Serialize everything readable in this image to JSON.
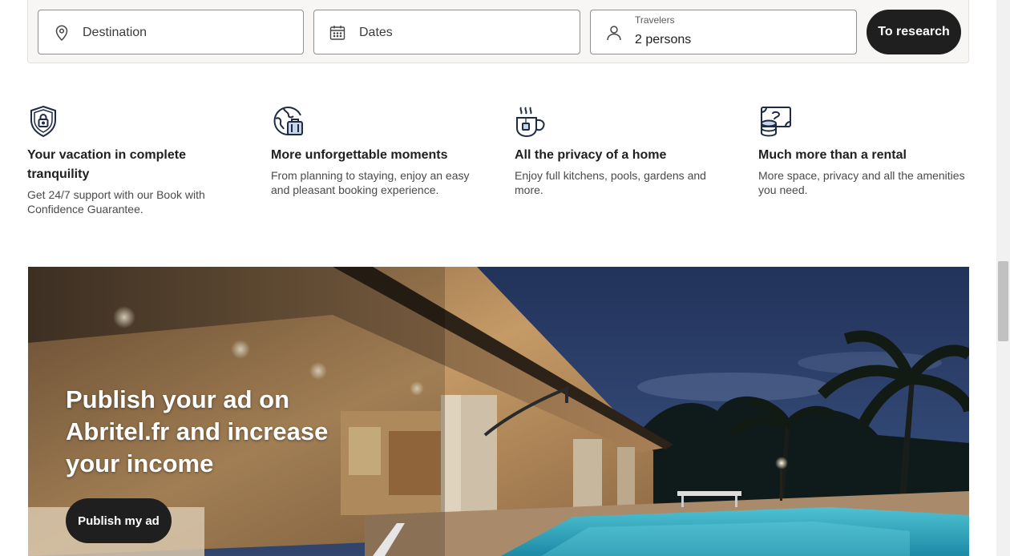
{
  "search": {
    "destination_placeholder": "Destination",
    "dates_placeholder": "Dates",
    "travelers_label": "Travelers",
    "travelers_value": "2 persons",
    "search_button": "To research"
  },
  "features": [
    {
      "icon": "shield-lock-icon",
      "title": "Your vacation in complete tranquility",
      "description": "Get 24/7 support with our Book with Confidence Guarantee."
    },
    {
      "icon": "globe-luggage-icon",
      "title": "More unforgettable moments",
      "description": "From planning to staying, enjoy an easy and pleasant booking experience."
    },
    {
      "icon": "coffee-cup-icon",
      "title": "All the privacy of a home",
      "description": "Enjoy full kitchens, pools, gardens and more."
    },
    {
      "icon": "money-coins-icon",
      "title": "Much more than a rental",
      "description": "More space, privacy and all the amenities you need."
    }
  ],
  "hero": {
    "title": "Publish your ad on Abritel.fr and increase your income",
    "button": "Publish my ad"
  }
}
